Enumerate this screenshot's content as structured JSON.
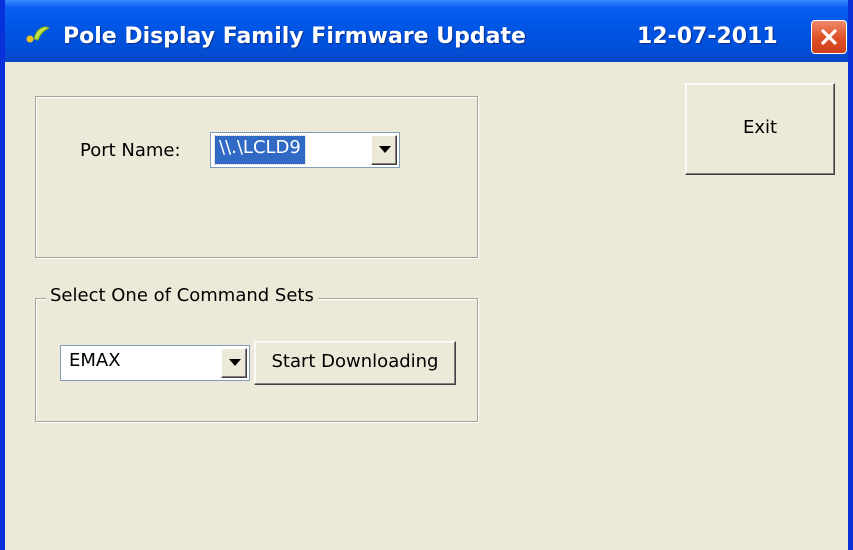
{
  "window": {
    "title": "Pole Display Family Firmware Update",
    "date": "12-07-2011",
    "close_glyph": "✕"
  },
  "port_group": {
    "port_label": "Port Name:",
    "port_value": "\\\\.\\LCLD9"
  },
  "command_group": {
    "legend": "Select One of Command Sets",
    "command_value": "EMAX",
    "start_label": "Start Downloading"
  },
  "exit_label": "Exit",
  "colors": {
    "titlebar": "#0055e5",
    "client": "#ece9d8",
    "close": "#e0532a",
    "selection": "#316ac5"
  },
  "icons": [
    "app-icon",
    "close-icon",
    "dropdown-arrow-icon"
  ]
}
